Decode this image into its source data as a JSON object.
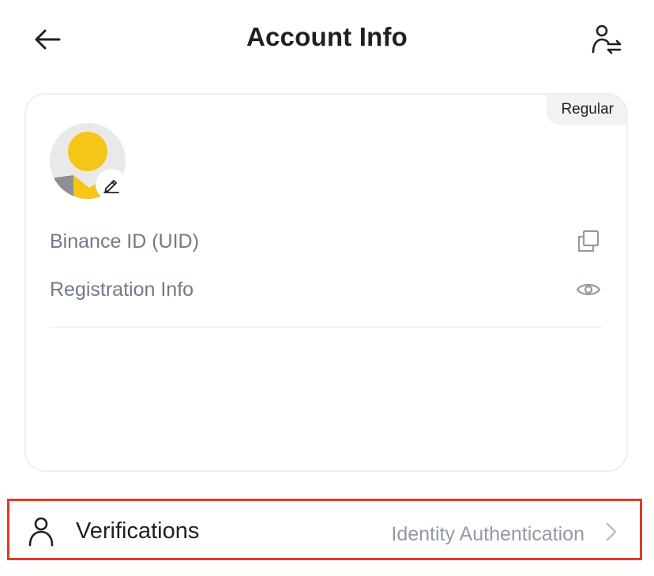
{
  "header": {
    "title": "Account Info"
  },
  "account_card": {
    "tier_badge": "Regular",
    "rows": [
      {
        "label": "Binance ID (UID)",
        "icon": "copy-icon"
      },
      {
        "label": "Registration Info",
        "icon": "eye-icon"
      }
    ]
  },
  "verifications": {
    "label": "Verifications",
    "value": "Identity Authentication",
    "icon": "person-icon"
  },
  "colors": {
    "text_primary": "#1e2026",
    "text_secondary": "#707a8a",
    "avatar_yellow": "#f5c518",
    "highlight_border": "#e23a25"
  }
}
